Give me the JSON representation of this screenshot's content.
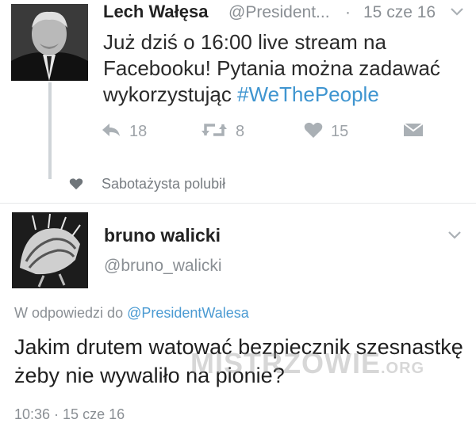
{
  "tweet": {
    "author_name": "Lech Wałęsa",
    "author_handle": "@President...",
    "separator": "·",
    "date": "15 cze 16",
    "text_before_hashtag": "Już dziś o 16:00 live stream na Facebooku! Pytania można zadawać wykorzystując ",
    "hashtag": "#WeThePeople",
    "actions": {
      "reply_count": "18",
      "retweet_count": "8",
      "like_count": "15"
    }
  },
  "liked_by": {
    "text": "Sabotażysta polubił"
  },
  "reply": {
    "author_name": "bruno walicki",
    "author_handle": "@bruno_walicki",
    "in_reply_to_prefix": "W odpowiedzi do ",
    "in_reply_to_handle": "@PresidentWalesa",
    "text": "Jakim drutem watować bezpiecznik szesnastkę żeby nie wywaliło na pionie?",
    "timestamp": "10:36 · 15 cze 16"
  },
  "watermark": {
    "main": "MISTRZOWIE",
    "suffix": ".ORG"
  },
  "colors": {
    "link": "#3f95d0",
    "muted": "#8a8f94",
    "icon": "#aab0b5",
    "thread_line": "#cfd4d8"
  },
  "icons": [
    "reply-icon",
    "retweet-icon",
    "heart-icon",
    "dm-icon",
    "chevron-down-icon"
  ]
}
